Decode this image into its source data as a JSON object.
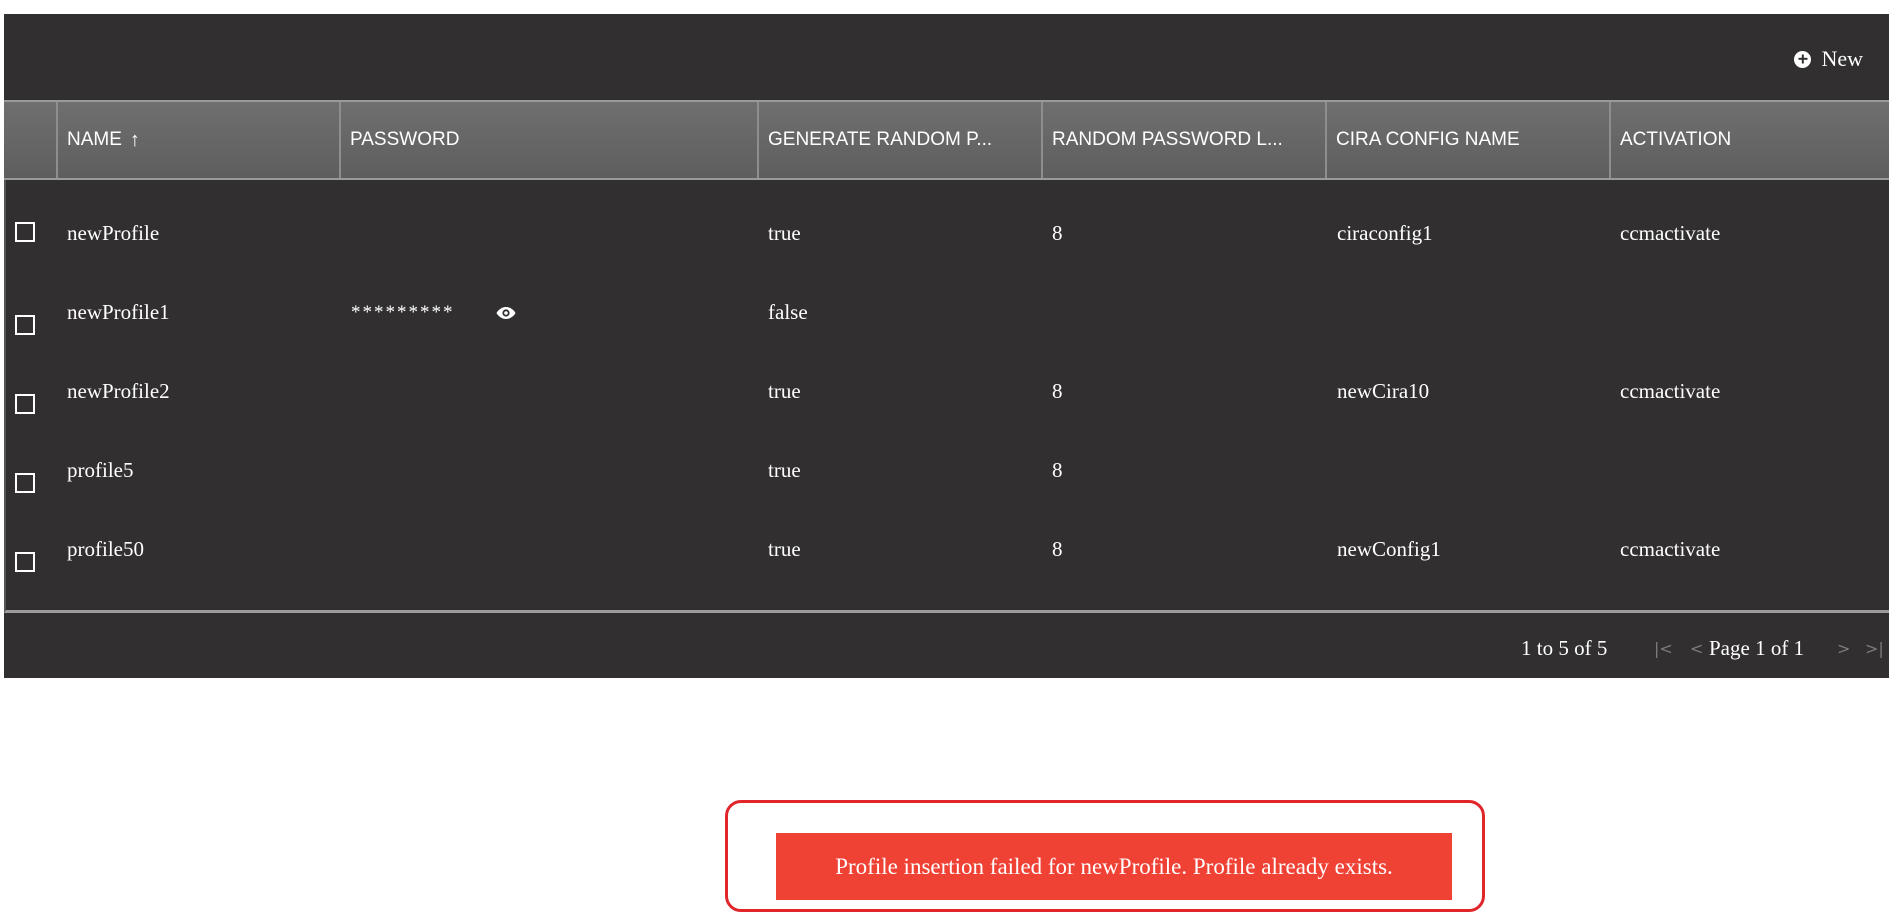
{
  "toolbar": {
    "new_label": "New",
    "new_icon": "plus-circle-icon"
  },
  "columns": [
    {
      "label": "NAME",
      "sort": "ascending"
    },
    {
      "label": "PASSWORD"
    },
    {
      "label": "GENERATE RANDOM P..."
    },
    {
      "label": "RANDOM PASSWORD L..."
    },
    {
      "label": "CIRA CONFIG NAME"
    },
    {
      "label": "ACTIVATION"
    }
  ],
  "rows": [
    {
      "name": "newProfile",
      "password": "",
      "generate_random": "true",
      "random_length": "8",
      "cira_config": "ciraconfig1",
      "activation": "ccmactivate"
    },
    {
      "name": "newProfile1",
      "password": "*********",
      "generate_random": "false",
      "random_length": "",
      "cira_config": "",
      "activation": ""
    },
    {
      "name": "newProfile2",
      "password": "",
      "generate_random": "true",
      "random_length": "8",
      "cira_config": "newCira10",
      "activation": "ccmactivate"
    },
    {
      "name": "profile5",
      "password": "",
      "generate_random": "true",
      "random_length": "8",
      "cira_config": "",
      "activation": ""
    },
    {
      "name": "profile50",
      "password": "",
      "generate_random": "true",
      "random_length": "8",
      "cira_config": "newConfig1",
      "activation": "ccmactivate"
    }
  ],
  "pagination": {
    "range_text": "1 to 5 of 5",
    "page_text": "Page 1 of 1",
    "first_icon": "|<",
    "prev_icon": "<",
    "next_icon": ">",
    "last_icon": ">|"
  },
  "toast": {
    "message": "Profile insertion failed for newProfile. Profile already exists."
  },
  "colors": {
    "grid_bg": "#312f30",
    "header_bg": "#666666",
    "toast_bg": "#f04135",
    "toast_outline": "#e0262b"
  }
}
